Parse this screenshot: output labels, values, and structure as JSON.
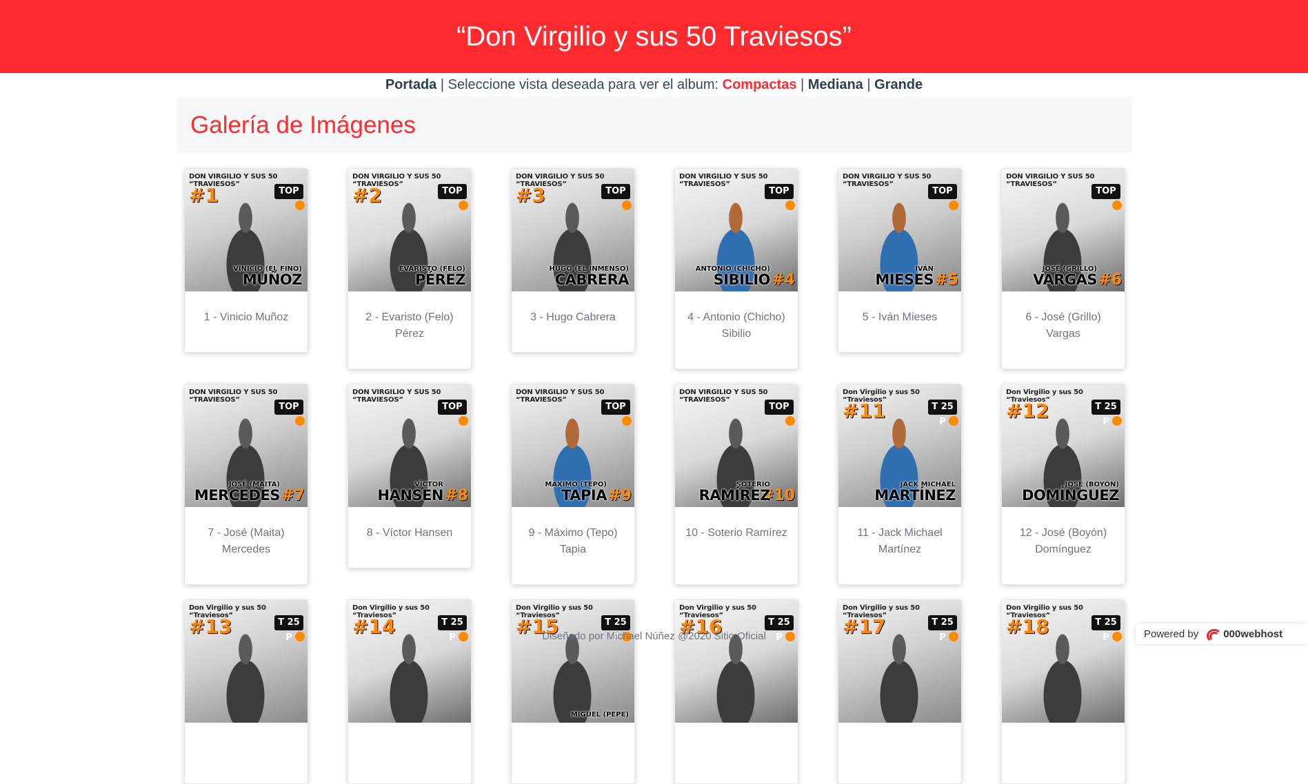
{
  "header": {
    "title": "“Don Virgilio y sus 50 Traviesos”"
  },
  "nav": {
    "portada": "Portada",
    "sep1": " | Seleccione vista deseada para ver el album: ",
    "compactas": "Compactas",
    "sep2": " | ",
    "mediana": "Mediana",
    "sep3": " | ",
    "grande": "Grande"
  },
  "gallery": {
    "title": "Galería de Imágenes",
    "banner_text_a": "DON VIRGILIO Y SUS 50 “TRAVIESOS”",
    "banner_text_b": "Don Virgilio y sus 50 “Traviesos”",
    "logo_a": "TOP",
    "logo_b": "T 25 P",
    "items": [
      {
        "caption": "1 - Vinicio Muñoz",
        "badge": "#1",
        "first": "VINICIO (EL FINO)",
        "last": "MUÑOZ"
      },
      {
        "caption": "2 - Evaristo (Felo) Pérez",
        "badge": "#2",
        "first": "EVARISTO (FELO)",
        "last": "PÉREZ"
      },
      {
        "caption": "3 - Hugo Cabrera",
        "badge": "#3",
        "first": "HUGO (EL INMENSO)",
        "last": "CABRERA"
      },
      {
        "caption": "4 - Antonio (Chicho) Sibilio",
        "badge": "#4",
        "first": "ANTONIO (CHICHO)",
        "last": "SIBILIO"
      },
      {
        "caption": "5 - Iván Mieses",
        "badge": "#5",
        "first": "IVÁN",
        "last": "MIESES"
      },
      {
        "caption": "6 - José (Grillo) Vargas",
        "badge": "#6",
        "first": "JOSÉ (GRILLO)",
        "last": "VARGAS"
      },
      {
        "caption": "7 - José (Maita) Mercedes",
        "badge": "#7",
        "first": "JOSÉ (MAITA)",
        "last": "MERCEDES"
      },
      {
        "caption": "8 - Víctor Hansen",
        "badge": "#8",
        "first": "VÍCTOR",
        "last": "HANSEN"
      },
      {
        "caption": "9 - Máximo (Tepo) Tapia",
        "badge": "#9",
        "first": "MÁXIMO (TEPO)",
        "last": "TAPIA"
      },
      {
        "caption": "10 - Soterio Ramírez",
        "badge": "#10",
        "first": "SOTERIO",
        "last": "RAMÍREZ"
      },
      {
        "caption": "11 - Jack Michael Martínez",
        "badge": "#11",
        "first": "JACK MICHAEL",
        "last": "MARTÍNEZ"
      },
      {
        "caption": "12 - José (Boyón) Domínguez",
        "badge": "#12",
        "first": "JOSÉ (BOYÓN)",
        "last": "DOMÍNGUEZ"
      },
      {
        "caption": "",
        "badge": "#13",
        "first": "",
        "last": ""
      },
      {
        "caption": "",
        "badge": "#14",
        "first": "",
        "last": ""
      },
      {
        "caption": "",
        "badge": "#15",
        "first": "MIGUEL (PEPE)",
        "last": ""
      },
      {
        "caption": "",
        "badge": "#16",
        "first": "",
        "last": ""
      },
      {
        "caption": "",
        "badge": "#17",
        "first": "",
        "last": ""
      },
      {
        "caption": "",
        "badge": "#18",
        "first": "",
        "last": ""
      }
    ]
  },
  "footer": {
    "text": "Diseñado por Michael Núñez @2020 Sitio Oficial"
  },
  "powered": {
    "label": "Powered by",
    "brand": "000webhost"
  }
}
